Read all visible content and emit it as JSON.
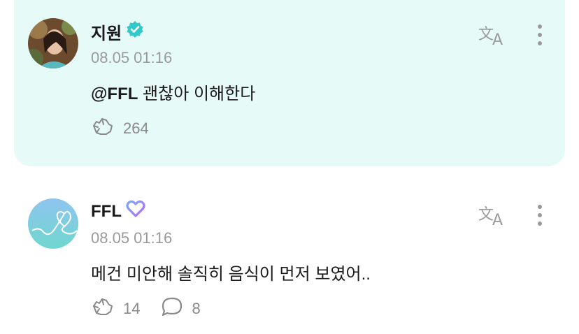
{
  "posts": [
    {
      "author": "지원",
      "verified": true,
      "timestamp": "08.05 01:16",
      "mention": "@FFL",
      "text": " 괜찮아 이해한다",
      "likes": "264"
    },
    {
      "author": "FFL",
      "timestamp": "08.05 01:16",
      "text": "메건 미안해 솔직히 음식이 먼저 보였어..",
      "likes": "14",
      "comments": "8"
    }
  ],
  "colors": {
    "highlight_bg": "#e6faf7",
    "verified": "#33c9c9",
    "muted": "#9a9a9a"
  }
}
